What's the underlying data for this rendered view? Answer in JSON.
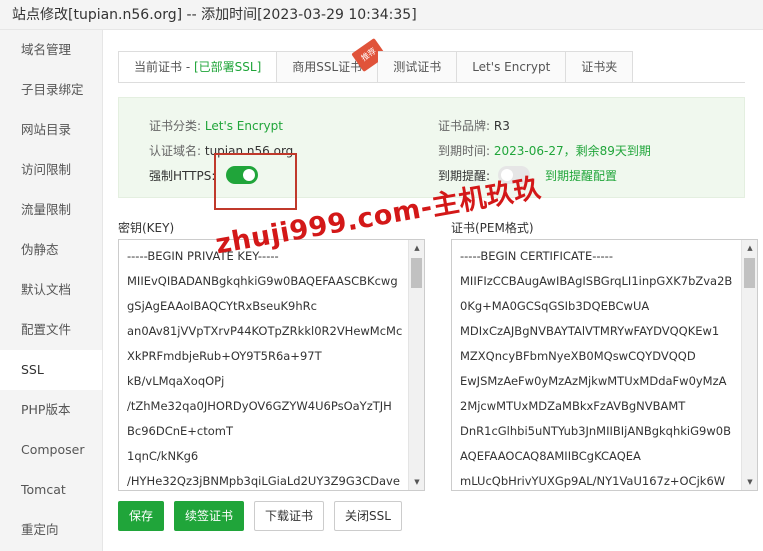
{
  "window": {
    "title": "站点修改[tupian.n56.org] -- 添加时间[2023-03-29 10:34:35]"
  },
  "sidebar": {
    "items": [
      {
        "label": "域名管理"
      },
      {
        "label": "子目录绑定"
      },
      {
        "label": "网站目录"
      },
      {
        "label": "访问限制"
      },
      {
        "label": "流量限制"
      },
      {
        "label": "伪静态"
      },
      {
        "label": "默认文档"
      },
      {
        "label": "配置文件"
      },
      {
        "label": "SSL"
      },
      {
        "label": "PHP版本"
      },
      {
        "label": "Composer"
      },
      {
        "label": "Tomcat"
      },
      {
        "label": "重定向"
      }
    ],
    "active_index": 8
  },
  "tabs": {
    "current": {
      "label": "当前证书 - ",
      "status": "[已部署SSL]"
    },
    "commercial": {
      "label": "商用SSL证书",
      "badge": "推荐"
    },
    "test": {
      "label": "测试证书"
    },
    "letsencrypt": {
      "label": "Let's Encrypt"
    },
    "folder": {
      "label": "证书夹"
    }
  },
  "info": {
    "category_label": "证书分类:",
    "category_value": "Let's Encrypt",
    "brand_label": "证书品牌:",
    "brand_value": "R3",
    "domain_label": "认证域名:",
    "domain_value": "tupian.n56.org",
    "expire_label": "到期时间:",
    "expire_value": "2023-06-27，剩余89天到期",
    "https_label": "强制HTTPS:",
    "https_enabled": true,
    "remind_label": "到期提醒:",
    "remind_enabled": false,
    "remind_link": "到期提醒配置"
  },
  "key": {
    "label": "密钥(KEY)",
    "lines": [
      "-----BEGIN PRIVATE KEY-----",
      "MIIEvQIBADANBgkqhkiG9w0BAQEFAASCBKcwg",
      "gSjAgEAAoIBAQCYtRxBseuK9hRc",
      "an0Av81jVVpTXrvP44KOTpZRkkl0R2VHewMcMc",
      "XkPRFmdbjeRub+OY9T5R6a+97T",
      "kB/vLMqaXoqOPj",
      "/tZhMe32qa0JHORDyOV6GZYW4U6PsOaYzTJH",
      "Bc96DCnE+ctomT",
      "1qnC/kNKg6",
      "/HYHe32Qz3jBNMpb3qiLGiaLd2UY3Z9G3CDave"
    ]
  },
  "cert": {
    "label": "证书(PEM格式)",
    "lines": [
      "-----BEGIN CERTIFICATE-----",
      "MIIFIzCCBAugAwIBAgISBGrqLI1inpGXK7bZva2B",
      "0Kg+MA0GCSqGSIb3DQEBCwUA",
      "MDIxCzAJBgNVBAYTAlVTMRYwFAYDVQQKEw1",
      "MZXQncyBFbmNyeXB0MQswCQYDVQQD",
      "EwJSMzAeFw0yMzAzMjkwMTUxMDdaFw0yMzA",
      "2MjcwMTUxMDZaMBkxFzAVBgNVBAMT",
      "DnR1cGlhbi5uNTYub3JnMIIBIjANBgkqhkiG9w0B",
      "AQEFAAOCAQ8AMIIBCgKCAQEA",
      "mLUcQbHrivYUXGp9AL/NY1VaU167z+OCjk6W"
    ]
  },
  "buttons": {
    "save": "保存",
    "renew": "续签证书",
    "download": "下载证书",
    "close_ssl": "关闭SSL"
  },
  "watermark": {
    "text": "zhuji999.com-主机玖玖"
  },
  "colors": {
    "accent": "#20a53a",
    "highlight": "#c0392b",
    "badge": "#e0533a"
  }
}
